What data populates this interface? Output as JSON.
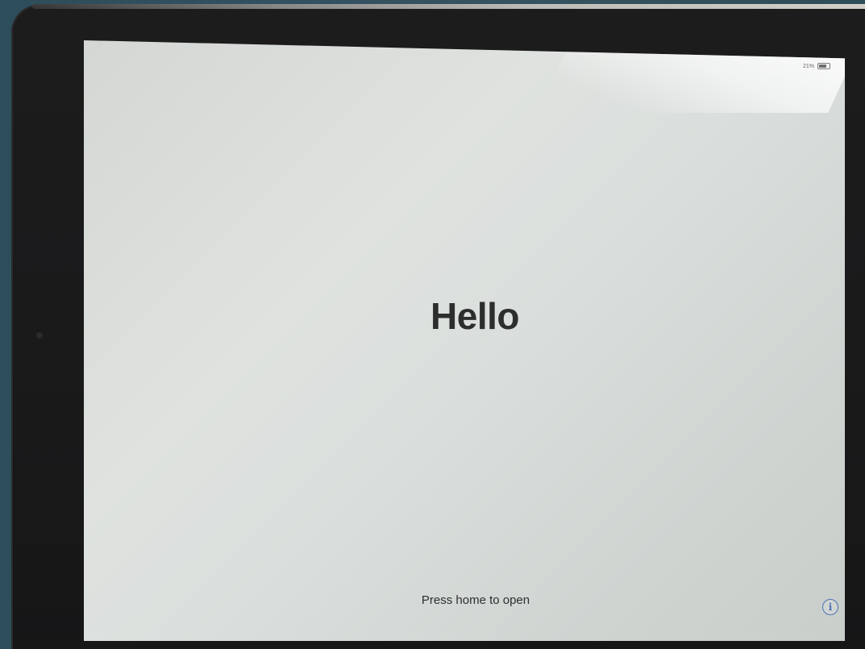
{
  "status_bar": {
    "battery_percent": "21%",
    "battery_level": 0.21
  },
  "lock_screen": {
    "greeting": "Hello",
    "hint": "Press home to open",
    "info_glyph": "i"
  },
  "icons": {
    "info": "info-icon",
    "battery": "battery-icon"
  },
  "colors": {
    "info_icon": "#4b73b8",
    "greeting_text": "#2c2e2e"
  }
}
